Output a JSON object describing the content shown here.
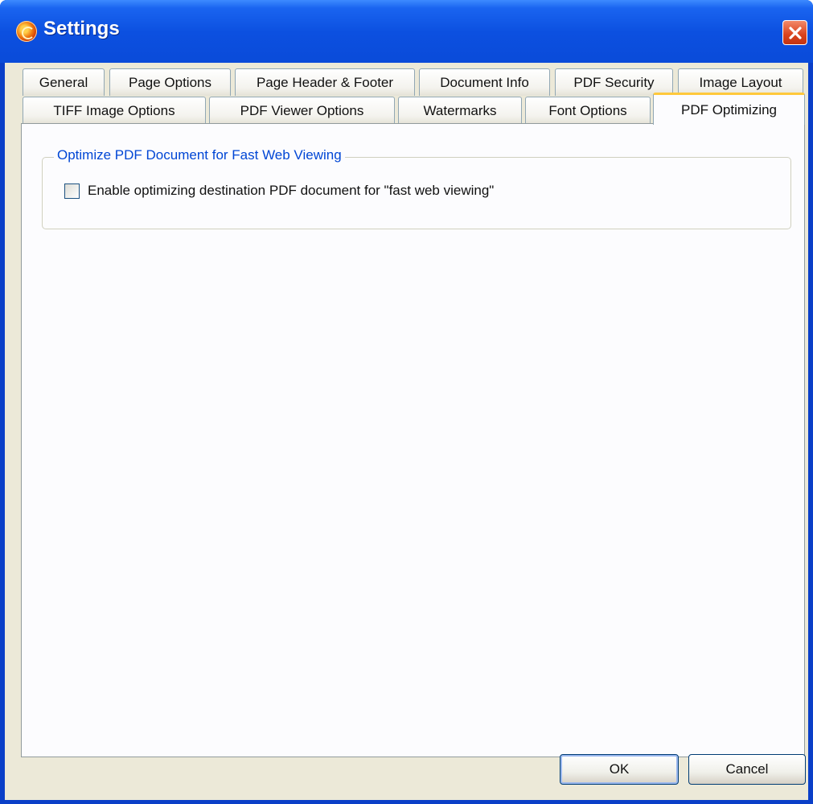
{
  "window": {
    "title": "Settings"
  },
  "tabs_row1": [
    {
      "label": "General"
    },
    {
      "label": "Page Options"
    },
    {
      "label": "Page Header & Footer"
    },
    {
      "label": "Document Info"
    },
    {
      "label": "PDF Security"
    },
    {
      "label": "Image Layout"
    }
  ],
  "tabs_row2": [
    {
      "label": "TIFF Image Options"
    },
    {
      "label": "PDF Viewer Options"
    },
    {
      "label": "Watermarks"
    },
    {
      "label": "Font Options"
    },
    {
      "label": "PDF Optimizing",
      "active": true
    }
  ],
  "panel": {
    "group_title": "Optimize PDF Document for Fast Web Viewing",
    "checkbox_label": "Enable optimizing destination PDF document for \"fast web viewing\"",
    "checkbox_checked": false
  },
  "buttons": {
    "ok": "OK",
    "cancel": "Cancel"
  },
  "colors": {
    "titlebar": "#0a4bd9",
    "active_tab_accent": "#ffc83c",
    "group_title": "#0046d5",
    "dialog_bg": "#ece9d8"
  }
}
